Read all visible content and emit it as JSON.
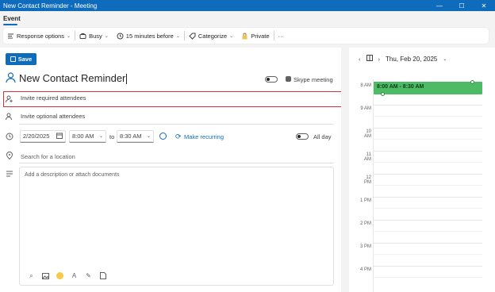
{
  "window": {
    "title": "New Contact Reminder - Meeting",
    "controls": [
      "—",
      "☐",
      "✕"
    ]
  },
  "tabs": {
    "event_label": "Event"
  },
  "ribbon": {
    "response_options": "Response options",
    "busy": "Busy",
    "reminder": "15 minutes before",
    "categorize": "Categorize",
    "private": "Private",
    "more": "···"
  },
  "form": {
    "save_label": "Save",
    "title_value": "New Contact Reminder",
    "skype_label": "Skype meeting",
    "required_attendees_placeholder": "Invite required attendees",
    "optional_attendees_placeholder": "Invite optional attendees",
    "start_date": "2/20/2025",
    "start_time": "8:00 AM",
    "to_label": "to",
    "end_time": "8:30 AM",
    "make_recurring": "Make recurring",
    "all_day": "All day",
    "location_placeholder": "Search for a location",
    "description_placeholder": "Add a description or attach documents"
  },
  "calendar": {
    "date_label": "Thu, Feb 20, 2025",
    "hours": [
      "8 AM",
      "9 AM",
      "10 AM",
      "11 AM",
      "12 PM",
      "1 PM",
      "2 PM",
      "3 PM",
      "4 PM"
    ],
    "event_label": "8:00 AM - 8:30 AM",
    "event_color": "#4dbb66"
  },
  "colors": {
    "accent": "#0f6cbd",
    "highlight_border": "#d13438"
  }
}
